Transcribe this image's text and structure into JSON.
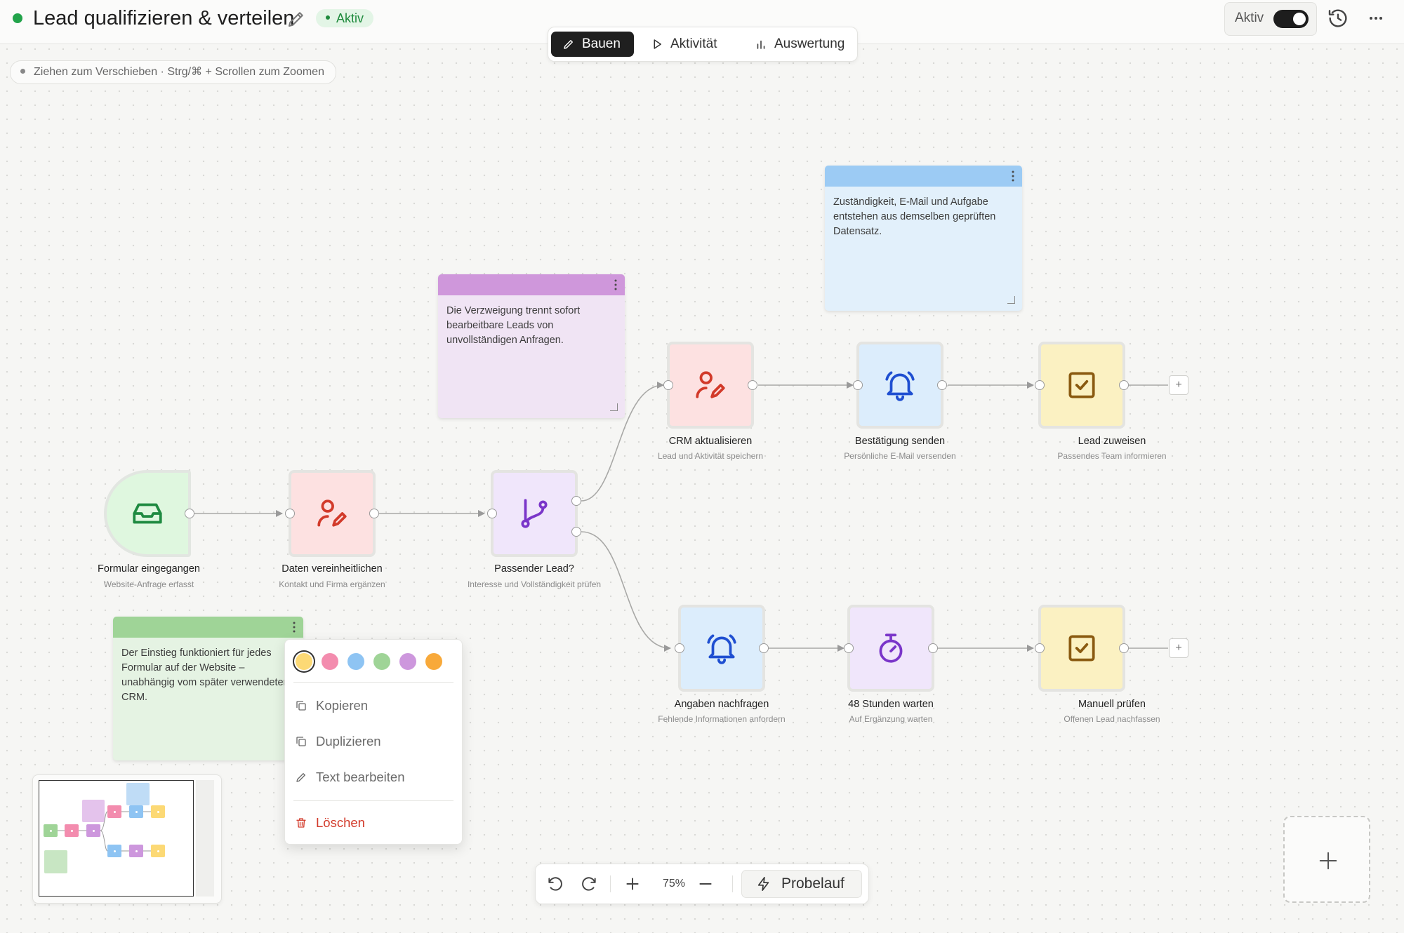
{
  "header": {
    "title": "Lead qualifizieren & verteilen",
    "status_badge": "Aktiv",
    "toggle_label": "Aktiv",
    "toggle_on": true
  },
  "mode_tabs": [
    {
      "label": "Bauen",
      "icon": "pencil-icon",
      "active": true
    },
    {
      "label": "Aktivität",
      "icon": "play-icon",
      "active": false
    },
    {
      "label": "Auswertung",
      "icon": "bar-chart-icon",
      "active": false
    }
  ],
  "hint": "Ziehen zum Verschieben · Strg/⌘ + Scrollen zum Zoomen",
  "notes": {
    "purple": "Die Verzweigung trennt sofort bearbeitbare Leads von unvollständigen Anfragen.",
    "blue": "Zuständigkeit, E-Mail und Aufgabe entstehen aus demselben geprüften Datensatz.",
    "green": "Der Einstieg funktioniert für jedes Formular auf der Website – unabhängig vom später verwendeten CRM."
  },
  "nodes": {
    "trigger": {
      "label": "Formular eingegangen",
      "sub": "Website-Anfrage erfasst",
      "icon": "inbox-icon"
    },
    "normalize": {
      "label": "Daten vereinheitlichen",
      "sub": "Kontakt und Firma ergänzen",
      "icon": "user-edit-icon"
    },
    "branch": {
      "label": "Passender Lead?",
      "sub": "Interesse und Vollständigkeit prüfen",
      "icon": "git-branch-icon"
    },
    "crm": {
      "label": "CRM aktualisieren",
      "sub": "Lead und Aktivität speichern",
      "icon": "user-edit-icon"
    },
    "confirm": {
      "label": "Bestätigung senden",
      "sub": "Persönliche E-Mail versenden",
      "icon": "bell-icon"
    },
    "assign": {
      "label": "Lead zuweisen",
      "sub": "Passendes Team informieren",
      "icon": "check-square-icon"
    },
    "request": {
      "label": "Angaben nachfragen",
      "sub": "Fehlende Informationen anfordern",
      "icon": "bell-icon"
    },
    "wait": {
      "label": "48 Stunden warten",
      "sub": "Auf Ergänzung warten",
      "icon": "timer-icon"
    },
    "review": {
      "label": "Manuell prüfen",
      "sub": "Offenen Lead nachfassen",
      "icon": "check-square-icon"
    }
  },
  "context_menu": {
    "swatches": [
      "#fcd975",
      "#f38cae",
      "#8ec4f3",
      "#9fd497",
      "#cd97dd",
      "#f8a93a"
    ],
    "selected_swatch": "#fcd975",
    "copy": "Kopieren",
    "duplicate": "Duplizieren",
    "edit_text": "Text bearbeiten",
    "delete": "Löschen"
  },
  "toolbar": {
    "zoom": "75%",
    "trial_run": "Probelauf"
  },
  "colors": {
    "accent_green": "#22a34a",
    "delete_red": "#d23a2a",
    "node_green": "#dff7df",
    "node_red": "#fde1e1",
    "node_purple": "#f0e6fb",
    "node_blue": "#dcedfc",
    "node_yellow": "#fbf1c2"
  }
}
